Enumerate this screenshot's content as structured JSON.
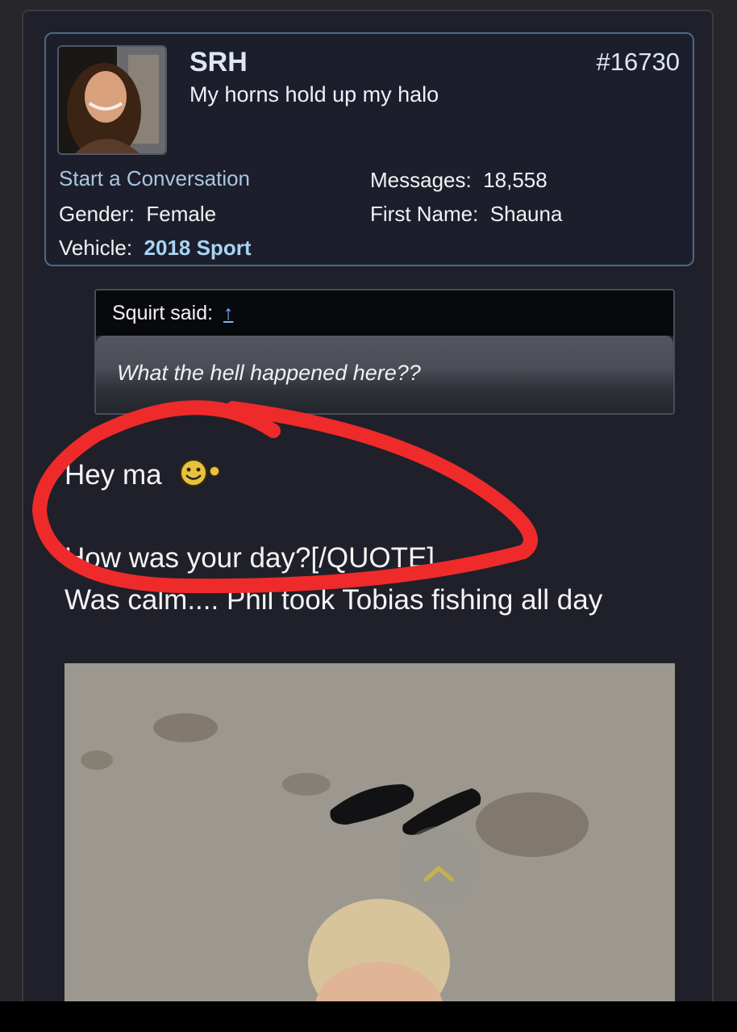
{
  "post": {
    "username": "SRH",
    "user_title": "My horns hold up my halo",
    "post_number": "#16730",
    "start_conversation": "Start a Conversation",
    "gender_label": "Gender:",
    "gender_value": "Female",
    "vehicle_label": "Vehicle:",
    "vehicle_value": "2018 Sport",
    "messages_label": "Messages:",
    "messages_value": "18,558",
    "first_name_label": "First Name:",
    "first_name_value": "Shauna"
  },
  "quote": {
    "author_said": "Squirt said:",
    "arrow": "↑",
    "text": "What the hell happened here??"
  },
  "message": {
    "line1": "Hey ma",
    "line2": "How was your day?[/QUOTE]",
    "line3": "Was calm.... Phil took Tobias fishing all day"
  },
  "colors": {
    "annotation_circle": "#ef2a2a",
    "link": "#a9c6e2",
    "card_border": "#4a6a86"
  }
}
